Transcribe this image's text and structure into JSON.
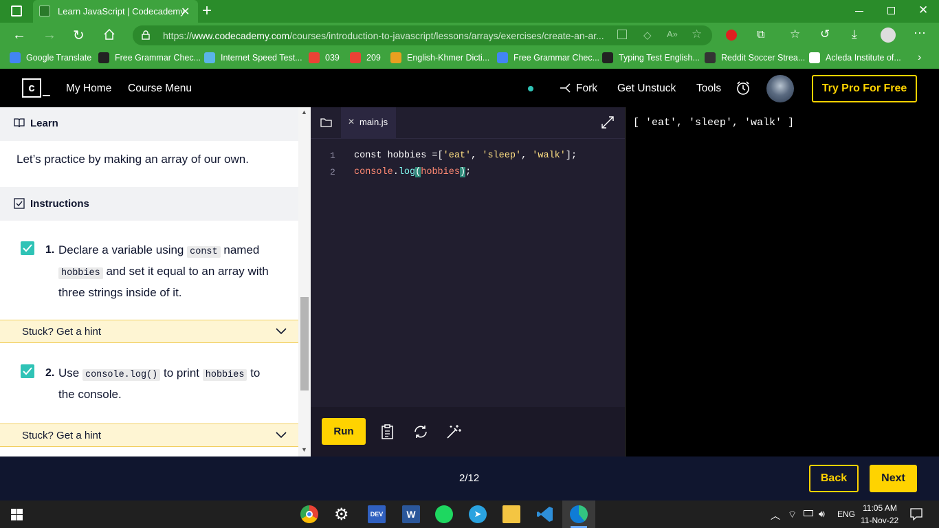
{
  "browser": {
    "tab_title": "Learn JavaScript | Codecademy",
    "url_prefix": "https://",
    "url_host": "www.codecademy.com",
    "url_path": "/courses/introduction-to-javascript/lessons/arrays/exercises/create-an-ar...",
    "bookmarks": [
      {
        "label": "Google Translate",
        "icon": "google-translate-icon",
        "color": "#4285f4"
      },
      {
        "label": "Free Grammar Chec...",
        "icon": "pen-icon",
        "color": "#222222"
      },
      {
        "label": "Internet Speed Test...",
        "icon": "speedtest-icon",
        "color": "#5ab4e8"
      },
      {
        "label": "039",
        "icon": "gmail-icon",
        "color": "#ea4335"
      },
      {
        "label": "209",
        "icon": "gmail-icon",
        "color": "#ea4335"
      },
      {
        "label": "English-Khmer Dicti...",
        "icon": "dictionary-icon",
        "color": "#e8a020"
      },
      {
        "label": "Free Grammar Chec...",
        "icon": "google-icon",
        "color": "#4285f4"
      },
      {
        "label": "Typing Test English...",
        "icon": "typing-icon",
        "color": "#222222"
      },
      {
        "label": "Reddit Soccer Strea...",
        "icon": "soccer-icon",
        "color": "#333333"
      },
      {
        "label": "Acleda Institute of...",
        "icon": "document-icon",
        "color": "#ffffff"
      }
    ]
  },
  "header": {
    "logo": "C_",
    "my_home": "My Home",
    "course_menu": "Course Menu",
    "fork": "Fork",
    "get_unstuck": "Get Unstuck",
    "tools": "Tools",
    "try_pro": "Try Pro For Free"
  },
  "learn": {
    "title": "Learn",
    "text": "Let’s practice by making an array of our own."
  },
  "instructions": {
    "title": "Instructions",
    "steps": [
      {
        "num": "1.",
        "p1": "Declare a variable using",
        "c1": "const",
        "p2": "named",
        "c2": "hobbies",
        "p3": "and set it equal to an array with three strings inside of it."
      },
      {
        "num": "2.",
        "p1": "Use",
        "c1": "console.log()",
        "p2": "to print",
        "c2": "hobbies",
        "p3": "to the console."
      }
    ],
    "hint_label": "Stuck? Get a hint"
  },
  "editor": {
    "file_name": "main.js",
    "lines": [
      "1",
      "2"
    ],
    "run_label": "Run"
  },
  "output": {
    "text": "[ 'eat', 'sleep', 'walk' ]"
  },
  "footer": {
    "progress": "2/12",
    "back": "Back",
    "next": "Next"
  },
  "taskbar": {
    "language": "ENG",
    "time": "11:05 AM",
    "date": "11-Nov-22"
  },
  "colors": {
    "browser_green": "#3ea33e",
    "accent_yellow": "#ffd300",
    "check_teal": "#2fc3b6",
    "editor_bg": "#211e2f"
  }
}
